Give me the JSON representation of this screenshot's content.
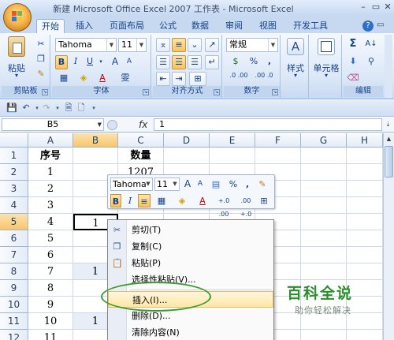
{
  "window": {
    "title": "新建 Microsoft Office Excel 2007 工作表 - Microsoft Excel",
    "minimize": "–",
    "restore": "▭",
    "close": "✕"
  },
  "tabs": [
    "开始",
    "插入",
    "页面布局",
    "公式",
    "数据",
    "审阅",
    "视图",
    "开发工具"
  ],
  "ribbon": {
    "clipboard": {
      "paste": "粘贴",
      "group": "剪贴板"
    },
    "font": {
      "name": "Tahoma",
      "size": "11",
      "bold": "B",
      "italic": "I",
      "underline": "U",
      "grow": "A",
      "shrink": "A",
      "color": "A",
      "phonetic": "雯",
      "group": "字体"
    },
    "alignment": {
      "group": "对齐方式"
    },
    "number": {
      "format": "常规",
      "percent": "%",
      "comma": ",",
      "inc_dec": ".0 .00",
      "dec_dec": ".00 .0",
      "currency": "$",
      "group": "数字"
    },
    "styles": {
      "label": "样式"
    },
    "cells": {
      "label": "单元格"
    },
    "editing": {
      "sum": "Σ",
      "sort": "A↓",
      "group": "编辑"
    }
  },
  "formula_bar": {
    "name_box": "B5",
    "fx": "fx",
    "value": "1"
  },
  "columns": [
    "A",
    "B",
    "C",
    "D",
    "E",
    "F",
    "G",
    "H"
  ],
  "rows": [
    {
      "num": "1",
      "a": "序号",
      "b": "",
      "c": "数量"
    },
    {
      "num": "2",
      "a": "1",
      "b": "",
      "c": "1207"
    },
    {
      "num": "3",
      "a": "2",
      "b": "",
      "c": ""
    },
    {
      "num": "4",
      "a": "3",
      "b": "",
      "c": ""
    },
    {
      "num": "5",
      "a": "4",
      "b": "1",
      "c": ""
    },
    {
      "num": "6",
      "a": "5",
      "b": "",
      "c": ""
    },
    {
      "num": "7",
      "a": "6",
      "b": "",
      "c": ""
    },
    {
      "num": "8",
      "a": "7",
      "b": "1",
      "c": ""
    },
    {
      "num": "9",
      "a": "8",
      "b": "",
      "c": ""
    },
    {
      "num": "10",
      "a": "9",
      "b": "",
      "c": ""
    },
    {
      "num": "11",
      "a": "10",
      "b": "1",
      "c": ""
    },
    {
      "num": "12",
      "a": "11",
      "b": "",
      "c": ""
    }
  ],
  "minibar": {
    "font": "Tahoma",
    "size": "11",
    "grow": "A",
    "shrink": "A",
    "percent": "%",
    "comma": ",",
    "bold": "B",
    "italic": "I",
    "color": "A",
    "inc_dec": "+.0 .00",
    "dec_dec": ".00 +.0"
  },
  "context_menu": {
    "items": [
      "剪切(T)",
      "复制(C)",
      "粘贴(P)",
      "选择性粘贴(V)...",
      "插入(I)...",
      "删除(D)...",
      "清除内容(N)"
    ]
  },
  "watermark": {
    "title": "百科全说",
    "subtitle": "助你轻松解决"
  }
}
